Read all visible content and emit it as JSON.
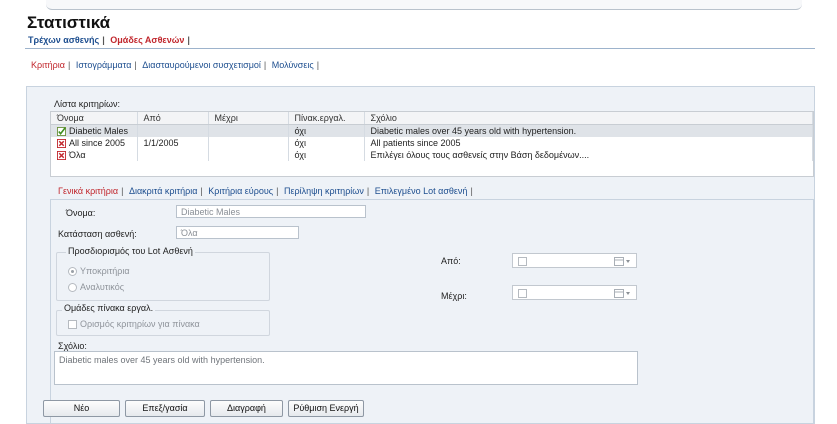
{
  "page": {
    "title": "Στατιστικά"
  },
  "main_tabs": [
    {
      "label": "Τρέχων ασθενής",
      "active": false
    },
    {
      "label": "Ομάδες Ασθενών",
      "active": true
    }
  ],
  "sub_tabs": [
    {
      "label": "Κριτήρια",
      "active": true
    },
    {
      "label": "Ιστογράμματα",
      "active": false
    },
    {
      "label": "Διασταυρούμενοι συσχετισμοί",
      "active": false
    },
    {
      "label": "Μολύνσεις",
      "active": false
    }
  ],
  "criteria_list": {
    "label": "Λίστα κριτηρίων:",
    "columns": [
      "Όνομα",
      "Από",
      "Μέχρι",
      "Πίνακ.εργαλ.",
      "Σχόλιο"
    ],
    "rows": [
      {
        "icon": "green-check-icon",
        "name": "Diabetic Males",
        "from": "",
        "to": "",
        "table": "όχι",
        "comment": "Diabetic males over 45 years old with hypertension.",
        "selected": true
      },
      {
        "icon": "red-x-icon",
        "name": "All since 2005",
        "from": "1/1/2005",
        "to": "",
        "table": "όχι",
        "comment": "All patients since 2005",
        "selected": false
      },
      {
        "icon": "red-x-icon",
        "name": "Όλα",
        "from": "",
        "to": "",
        "table": "όχι",
        "comment": "Επιλέγει όλους τους ασθενείς στην Βάση δεδομένων....",
        "selected": false
      }
    ]
  },
  "detail_tabs": [
    {
      "label": "Γενικά κριτήρια",
      "active": true
    },
    {
      "label": "Διακριτά κριτήρια",
      "active": false
    },
    {
      "label": "Κριτήρια εύρους",
      "active": false
    },
    {
      "label": "Περίληψη κριτηρίων",
      "active": false
    },
    {
      "label": "Επιλεγμένο Lot ασθενή",
      "active": false
    }
  ],
  "form": {
    "name_label": "Όνομα:",
    "name_value": "Diabetic Males",
    "status_label": "Κατάσταση ασθενή:",
    "status_value": "Όλα",
    "lot_group_label": "Προσδιορισμός του Lot Ασθενή",
    "radio_subcriteria": "Υποκριτήρια",
    "radio_analytic": "Αναλυτικός",
    "table_group_label": "Ομάδες πίνακα εργαλ.",
    "table_checkbox": "Ορισμός κριτηρίων για πίνακα",
    "from_label": "Από:",
    "to_label": "Μέχρι:",
    "comment_label": "Σχόλιο:",
    "comment_value": "Diabetic males over 45 years old with hypertension."
  },
  "buttons": {
    "new": "Νέο",
    "edit": "Επεξ/γασία",
    "delete": "Διαγραφή",
    "activate": "Ρύθμιση Ενεργή"
  },
  "colors": {
    "active_tab": "#c1272d",
    "tab": "#1d4e8f",
    "panel": "#eef2f7"
  }
}
